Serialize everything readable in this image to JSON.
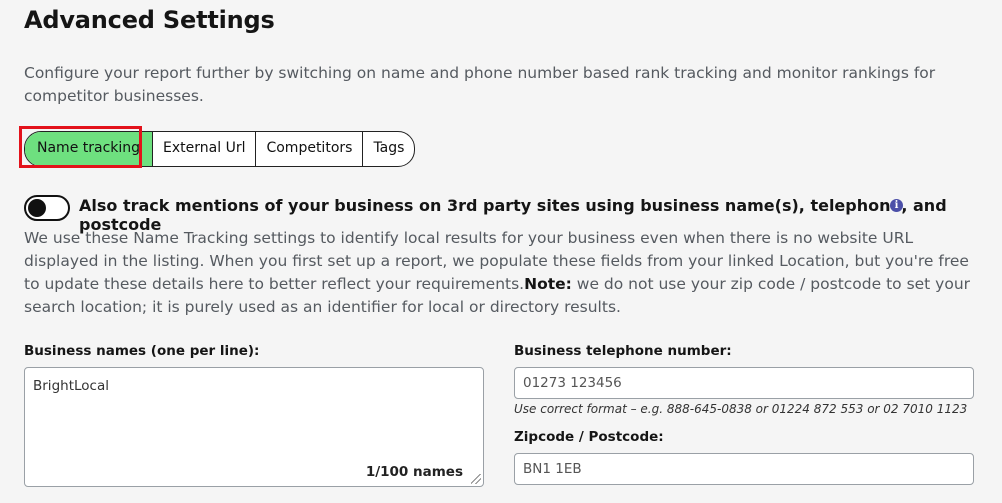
{
  "header": {
    "title": "Advanced Settings",
    "intro": "Configure your report further by switching on name and phone number based rank tracking and monitor rankings for competitor businesses."
  },
  "tabs": [
    {
      "label": "Name tracking",
      "active": true
    },
    {
      "label": "External Url",
      "active": false
    },
    {
      "label": "Competitors",
      "active": false
    },
    {
      "label": "Tags",
      "active": false
    }
  ],
  "toggle": {
    "state": "off",
    "label": "Also track mentions of your business on 3rd party sites using business name(s), telephone, and postcode"
  },
  "description": {
    "text": "We use these Name Tracking settings to identify local results for your business even when there is no website URL displayed in the listing. When you first set up a report, we populate these fields from your linked Location, but you're free to update these details here to better reflect your requirements.",
    "note_label": "Note:",
    "note_text": " we do not use your zip code / postcode to set your search location; it is purely used as an identifier for local or directory results."
  },
  "form": {
    "business_names": {
      "label": "Business names (one per line):",
      "value": "BrightLocal",
      "count": "1/100 names"
    },
    "telephone": {
      "label": "Business telephone number:",
      "value": "01273 123456",
      "hint": "Use correct format – e.g. 888-645-0838 or 01224 872 553 or 02 7010 1123"
    },
    "postcode": {
      "label": "Zipcode / Postcode:",
      "value": "BN1 1EB"
    }
  },
  "colors": {
    "active_tab": "#6ee07f",
    "highlight": "#e3121b",
    "info_icon": "#4b4fa8"
  }
}
